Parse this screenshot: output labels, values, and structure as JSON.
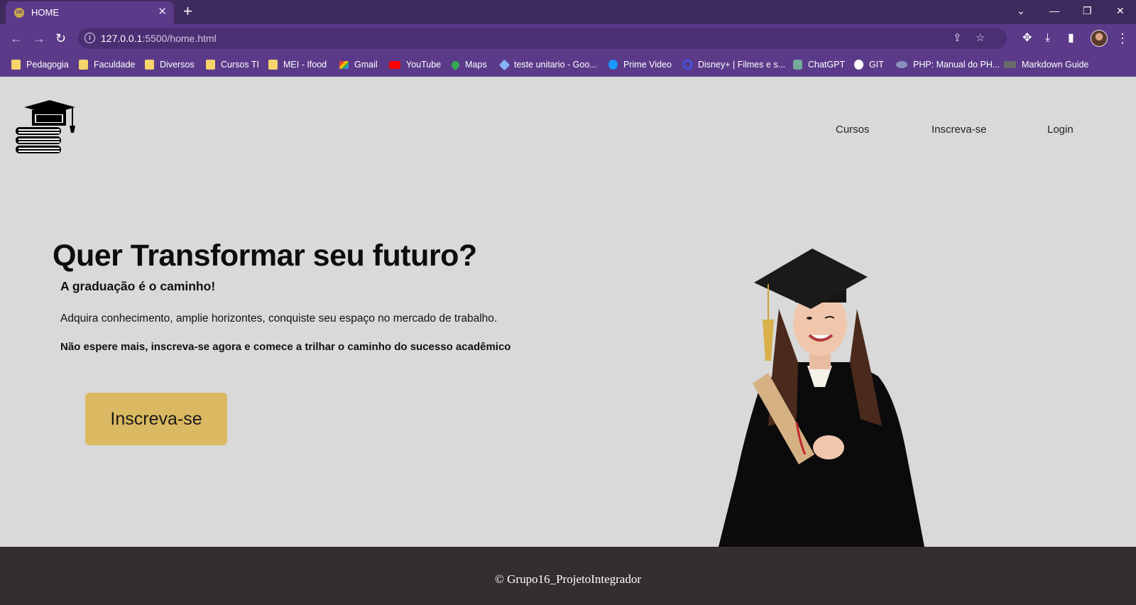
{
  "browser": {
    "tab_title": "HOME",
    "favicon_text": "GR",
    "new_tab_label": "+",
    "url_host": "127.0.0.1",
    "url_rest": ":5500/home.html",
    "bookmarks": [
      {
        "label": "Pedagogia",
        "icon": "folder-icon"
      },
      {
        "label": "Faculdade",
        "icon": "folder-icon"
      },
      {
        "label": "Diversos",
        "icon": "folder-icon"
      },
      {
        "label": "Cursos TI",
        "icon": "folder-icon"
      },
      {
        "label": "MEI - Ifood",
        "icon": "folder-icon"
      },
      {
        "label": "Gmail",
        "icon": "gmail-icon"
      },
      {
        "label": "YouTube",
        "icon": "youtube-icon"
      },
      {
        "label": "Maps",
        "icon": "maps-icon"
      },
      {
        "label": "teste unitario - Goo...",
        "icon": "google-icon"
      },
      {
        "label": "Prime Video",
        "icon": "prime-video-icon"
      },
      {
        "label": "Disney+ | Filmes e s...",
        "icon": "disney-icon"
      },
      {
        "label": "ChatGPT",
        "icon": "chatgpt-icon"
      },
      {
        "label": "GIT",
        "icon": "github-icon"
      },
      {
        "label": "PHP: Manual do PH...",
        "icon": "php-icon"
      },
      {
        "label": "Markdown Guide",
        "icon": "markdown-icon"
      }
    ]
  },
  "site": {
    "nav": [
      "Cursos",
      "Inscreva-se",
      "Login"
    ],
    "hero": {
      "title": "Quer Transformar seu futuro?",
      "subtitle": "A graduação é o caminho!",
      "description": "Adquira conhecimento, amplie horizontes, conquiste seu espaço no mercado de trabalho.",
      "cta_text": "Não espere mais, inscreva-se agora e comece a trilhar o caminho do sucesso acadêmico",
      "button_label": "Inscreva-se"
    },
    "footer": "© Grupo16_ProjetoIntegrador"
  },
  "colors": {
    "chrome": "#5b3a8a",
    "tabbar": "#3f2a5e",
    "page_bg": "#d9d9d9",
    "button": "#dbb962",
    "footer": "#342f2f"
  }
}
